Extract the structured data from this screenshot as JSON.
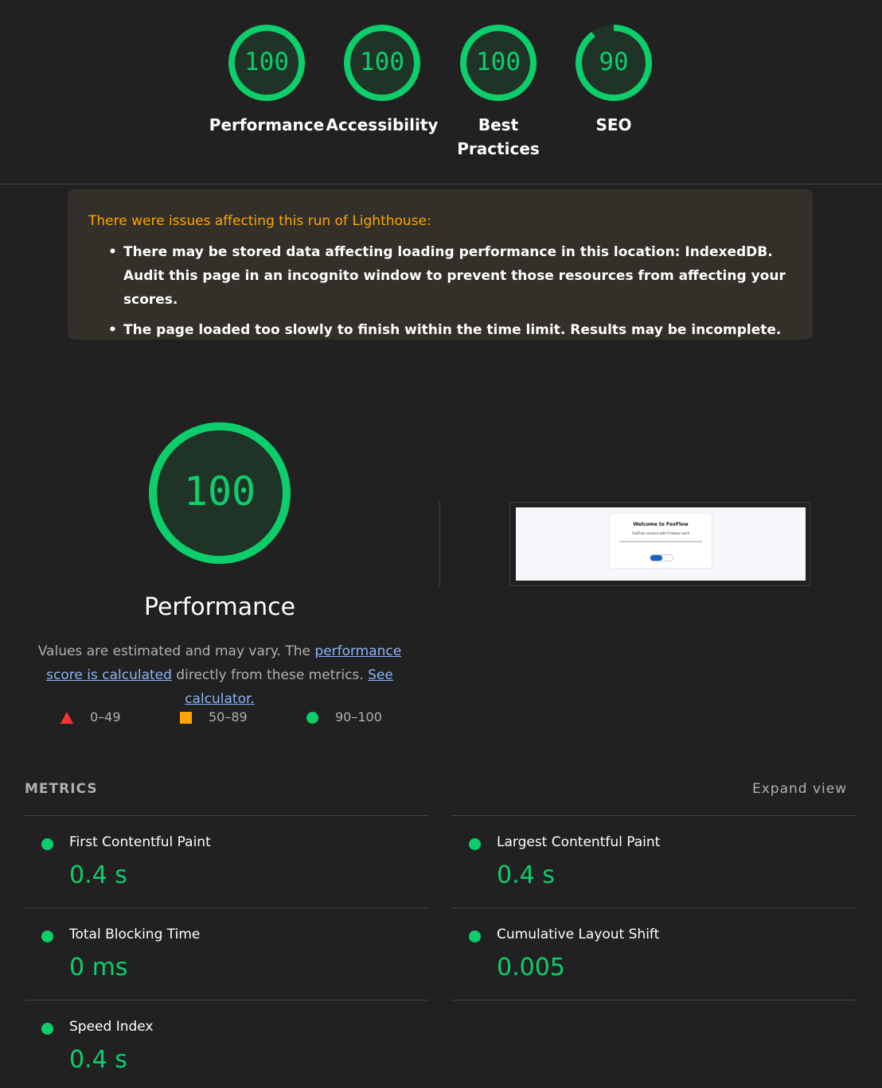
{
  "summary": {
    "categories": [
      {
        "label": "Performance",
        "score": "100",
        "fraction": 1.0
      },
      {
        "label": "Accessibility",
        "score": "100",
        "fraction": 1.0
      },
      {
        "label": "Best Practices",
        "score": "100",
        "fraction": 1.0
      },
      {
        "label": "SEO",
        "score": "90",
        "fraction": 0.9
      }
    ]
  },
  "warnings": {
    "title": "There were issues affecting this run of Lighthouse:",
    "items": [
      "There may be stored data affecting loading performance in this location: IndexedDB. Audit this page in an incognito window to prevent those resources from affecting your scores.",
      "The page loaded too slowly to finish within the time limit. Results may be incomplete."
    ]
  },
  "performance": {
    "score": "100",
    "fraction": 1.0,
    "label": "Performance",
    "desc_prefix": "Values are estimated and may vary. The ",
    "link1": "performance score is calculated",
    "desc_middle": " directly from these metrics. ",
    "link2": "See calculator.",
    "screenshot": {
      "title": "Welcome to FoxFlow",
      "subtitle": "FoxFlow connect with Firebase work"
    }
  },
  "legend": [
    {
      "range": "0–49",
      "shape": "triangle",
      "color": "#ff3333"
    },
    {
      "range": "50–89",
      "shape": "square",
      "color": "#ffa400"
    },
    {
      "range": "90–100",
      "shape": "circle",
      "color": "#0cce6b"
    }
  ],
  "metrics": {
    "header": "METRICS",
    "expand": "Expand view",
    "items": [
      {
        "title": "First Contentful Paint",
        "value": "0.4 s"
      },
      {
        "title": "Largest Contentful Paint",
        "value": "0.4 s"
      },
      {
        "title": "Total Blocking Time",
        "value": "0 ms"
      },
      {
        "title": "Cumulative Layout Shift",
        "value": "0.005"
      },
      {
        "title": "Speed Index",
        "value": "0.4 s"
      }
    ]
  },
  "colors": {
    "pass": "#0cce6b",
    "gauge_fill": "#1f3327",
    "warning_text": "#ffa400",
    "background": "#212121"
  }
}
